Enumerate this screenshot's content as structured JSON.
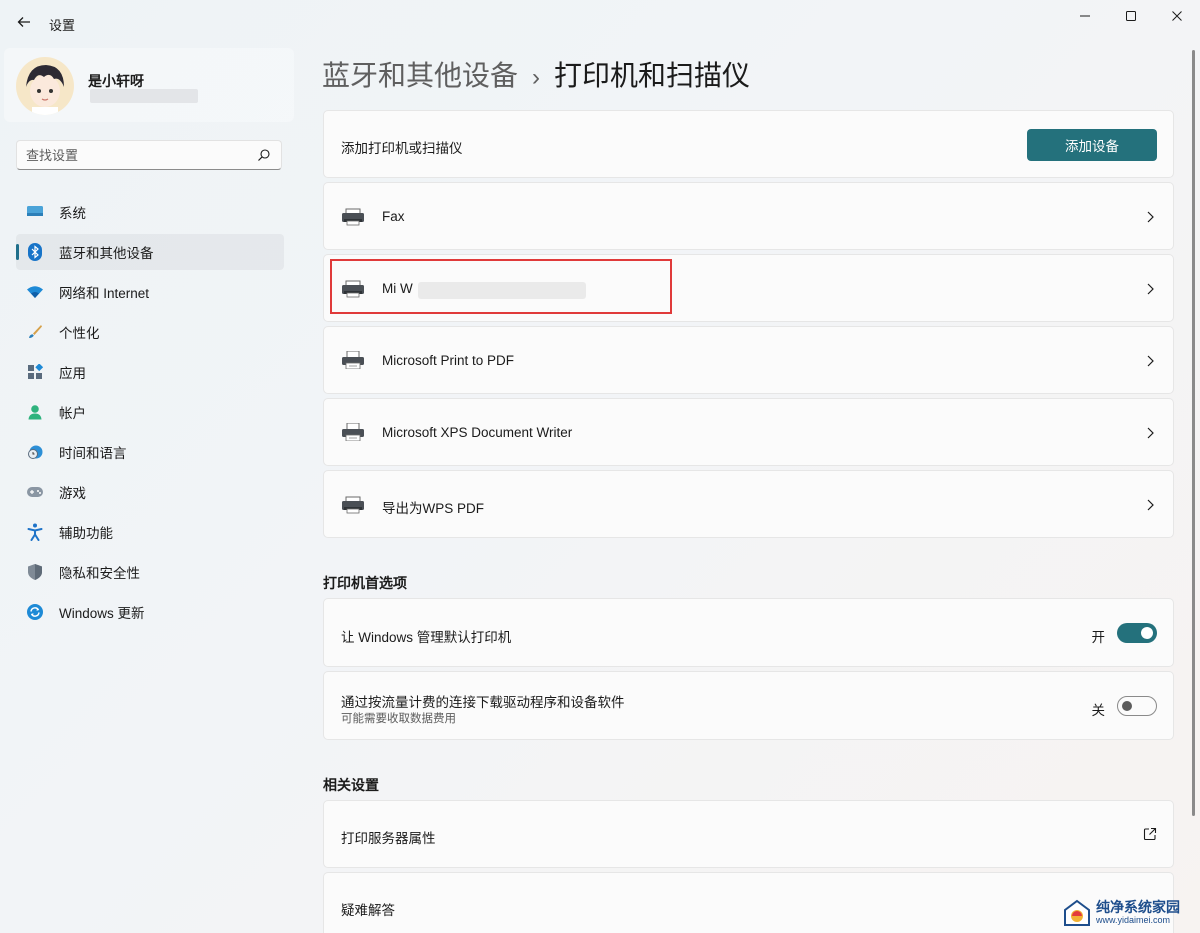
{
  "window": {
    "title": "设置"
  },
  "profile": {
    "name": "是小轩呀"
  },
  "search": {
    "placeholder": "查找设置"
  },
  "sidebar": {
    "items": [
      {
        "label": "系统",
        "icon": "monitor-icon",
        "active": false
      },
      {
        "label": "蓝牙和其他设备",
        "icon": "bluetooth-icon",
        "active": true
      },
      {
        "label": "网络和 Internet",
        "icon": "wifi-icon",
        "active": false
      },
      {
        "label": "个性化",
        "icon": "brush-icon",
        "active": false
      },
      {
        "label": "应用",
        "icon": "apps-icon",
        "active": false
      },
      {
        "label": "帐户",
        "icon": "account-icon",
        "active": false
      },
      {
        "label": "时间和语言",
        "icon": "clock-globe-icon",
        "active": false
      },
      {
        "label": "游戏",
        "icon": "gamepad-icon",
        "active": false
      },
      {
        "label": "辅助功能",
        "icon": "accessibility-icon",
        "active": false
      },
      {
        "label": "隐私和安全性",
        "icon": "shield-icon",
        "active": false
      },
      {
        "label": "Windows 更新",
        "icon": "update-icon",
        "active": false
      }
    ]
  },
  "breadcrumb": {
    "parent": "蓝牙和其他设备",
    "separator": "›",
    "current": "打印机和扫描仪"
  },
  "add_printer": {
    "label": "添加打印机或扫描仪",
    "button": "添加设备"
  },
  "printers": [
    {
      "name": "Fax",
      "icon": "printer-icon"
    },
    {
      "name": "Mi W",
      "icon": "printer-icon",
      "redacted": true
    },
    {
      "name": "Microsoft Print to PDF",
      "icon": "printer-pdf-icon"
    },
    {
      "name": "Microsoft XPS Document Writer",
      "icon": "printer-pdf-icon"
    },
    {
      "name": "导出为WPS PDF",
      "icon": "printer-icon"
    }
  ],
  "preferences": {
    "heading": "打印机首选项",
    "items": [
      {
        "label": "让 Windows 管理默认打印机",
        "sub": "",
        "state": "开",
        "on": true
      },
      {
        "label": "通过按流量计费的连接下载驱动程序和设备软件",
        "sub": "可能需要收取数据费用",
        "state": "关",
        "on": false
      }
    ]
  },
  "related": {
    "heading": "相关设置",
    "items": [
      {
        "label": "打印服务器属性",
        "icon": "external-link-icon"
      },
      {
        "label": "疑难解答",
        "icon": ""
      }
    ]
  },
  "watermark": {
    "text": "纯净系统家园",
    "url": "www.yidaimei.com"
  },
  "colors": {
    "accent": "#24717c",
    "highlight": "#e03a3a"
  }
}
